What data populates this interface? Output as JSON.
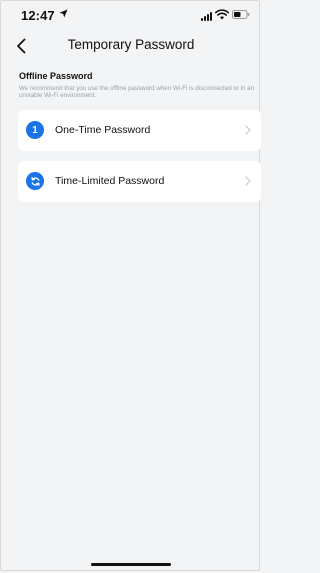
{
  "status_bar": {
    "time": "12:47",
    "location_icon": "location-arrow-icon",
    "signal_icon": "cellular-signal-icon",
    "wifi_icon": "wifi-icon",
    "battery_icon": "battery-icon"
  },
  "header": {
    "title": "Temporary Password",
    "back_icon": "chevron-left-icon"
  },
  "offline_section": {
    "title": "Offline Password",
    "description": "We recommend that you use the offline password when Wi-Fi is disconnected or in an unstable Wi-Fi environment."
  },
  "options": [
    {
      "label": "One-Time Password",
      "badge": "1",
      "icon": "one-time-icon"
    },
    {
      "label": "Time-Limited Password",
      "badge": "",
      "icon": "refresh-icon"
    }
  ],
  "colors": {
    "accent": "#1a73e8",
    "background": "#f3f4f6",
    "card": "#ffffff",
    "muted_text": "#9aa0a6"
  }
}
